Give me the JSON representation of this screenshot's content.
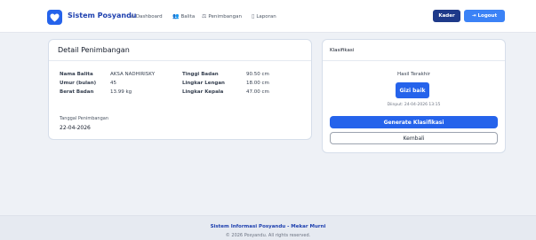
{
  "navbar": {
    "brand": "Sistem Posyandu",
    "links": [
      {
        "label": "Dashboard",
        "icon": "home-icon"
      },
      {
        "label": "Balita",
        "icon": "users-icon"
      },
      {
        "label": "Penimbangan",
        "icon": "scale-icon"
      },
      {
        "label": "Laporan",
        "icon": "document-icon"
      }
    ],
    "role_label": "Kader",
    "logout_label": "Logout"
  },
  "detail": {
    "title": "Detail Penimbangan",
    "rows": [
      {
        "label": "Nama Balita",
        "value": "AKSA NADHIRISKY"
      },
      {
        "label": "Umur (bulan)",
        "value": "45"
      },
      {
        "label": "Berat Badan",
        "value": "13.99 kg"
      },
      {
        "label": "Tinggi Badan",
        "value": "90.50 cm"
      },
      {
        "label": "Lingkar Lengan",
        "value": "18.00 cm"
      },
      {
        "label": "Lingkar Kepala",
        "value": "47.00 cm"
      }
    ],
    "tanggal_label": "Tanggal Penimbangan",
    "tanggal_value": "22-04-2026"
  },
  "klasifikasi": {
    "title": "Klasifikasi",
    "hasil_label": "Hasil Terakhir",
    "status": "Gizi baik",
    "diinput": "Diinput: 24-04-2026 13:15",
    "generate_label": "Generate Klasifikasi",
    "kembali_label": "Kembali"
  },
  "footer": {
    "title": "Sistem Informasi Posyandu - Mekar Murni",
    "copyright": "© 2026 Posyandu. All rights reserved."
  },
  "colors": {
    "primary": "#2563eb",
    "brand_text": "#1e40af",
    "kader_badge": "#1e3a8a",
    "logout_button": "#3b82f6",
    "background": "#eef1f6"
  }
}
